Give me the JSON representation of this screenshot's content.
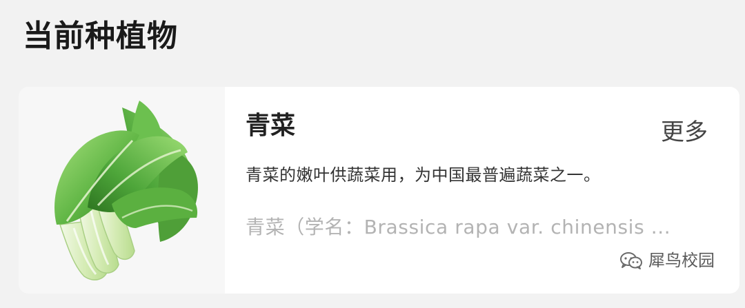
{
  "section": {
    "title": "当前种植物"
  },
  "plant": {
    "name": "青菜",
    "more_label": "更多",
    "description": "青菜的嫩叶供蔬菜用，为中国最普遍蔬菜之一。",
    "scientific_preview": "青菜（学名：Brassica rapa var. chinensis ...",
    "image_icon": "bok-choy-icon"
  },
  "watermark": {
    "icon": "wechat-icon",
    "text": "犀鸟校园"
  },
  "colors": {
    "background": "#f2f2f2",
    "card": "#ffffff",
    "leaf_dark": "#3f9a2c",
    "leaf_light": "#8cd36a",
    "stem": "#dff0c8"
  }
}
